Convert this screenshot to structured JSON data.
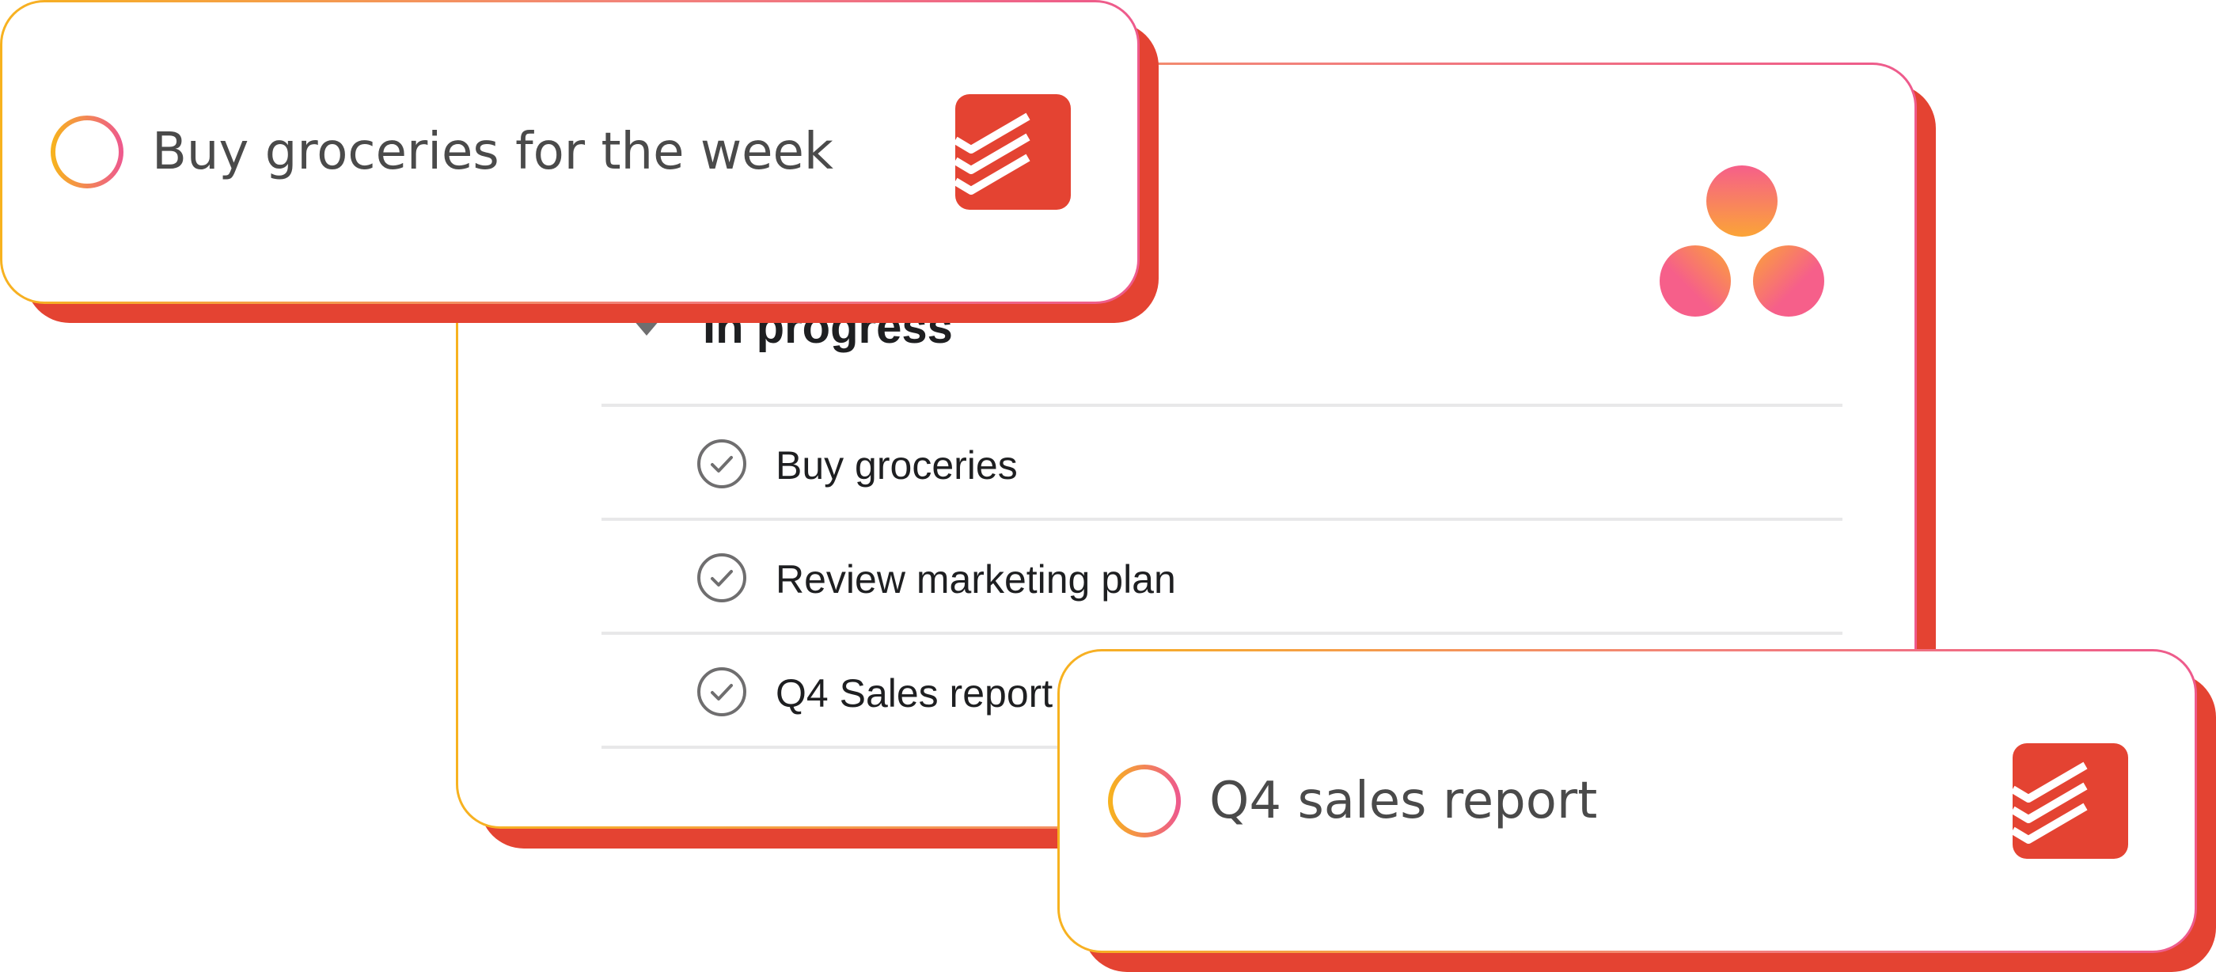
{
  "colors": {
    "todoist_red": "#e44332",
    "asana_coral": "#f06a6a",
    "gradient_start": "#f7b21f",
    "gradient_end": "#ee5a8c"
  },
  "asana_card": {
    "logo_icon": "asana-logo",
    "section": {
      "icon": "caret-down-icon",
      "title": "In progress"
    },
    "tasks": [
      {
        "icon": "check-circle-icon",
        "name": "Buy groceries"
      },
      {
        "icon": "check-circle-icon",
        "name": "Review marketing plan"
      },
      {
        "icon": "check-circle-icon",
        "name": "Q4 Sales report"
      }
    ]
  },
  "todoist_cards": [
    {
      "icon": "todoist-logo",
      "checkbox_icon": "circle-checkbox-icon",
      "text": "Buy groceries for the week"
    },
    {
      "icon": "todoist-logo",
      "checkbox_icon": "circle-checkbox-icon",
      "text": "Q4 sales report"
    }
  ]
}
